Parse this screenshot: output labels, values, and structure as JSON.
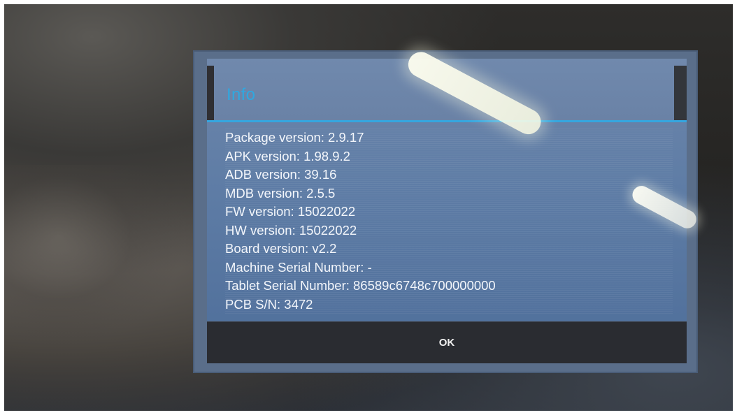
{
  "dialog": {
    "title": "Info",
    "lines": [
      "Package version: 2.9.17",
      "APK version: 1.98.9.2",
      "ADB version: 39.16",
      "MDB version: 2.5.5",
      "FW version: 15022022",
      "HW version: 15022022",
      "Board version: v2.2",
      "Machine Serial Number: -",
      "Tablet Serial Number: 86589c6748c700000000",
      "PCB S/N: 3472"
    ],
    "ok_label": "OK"
  },
  "colors": {
    "title": "#2fa8e0",
    "accent_rule": "#35a6df",
    "dialog_body": "#5f7da6",
    "button_bar": "#2a2c31"
  }
}
